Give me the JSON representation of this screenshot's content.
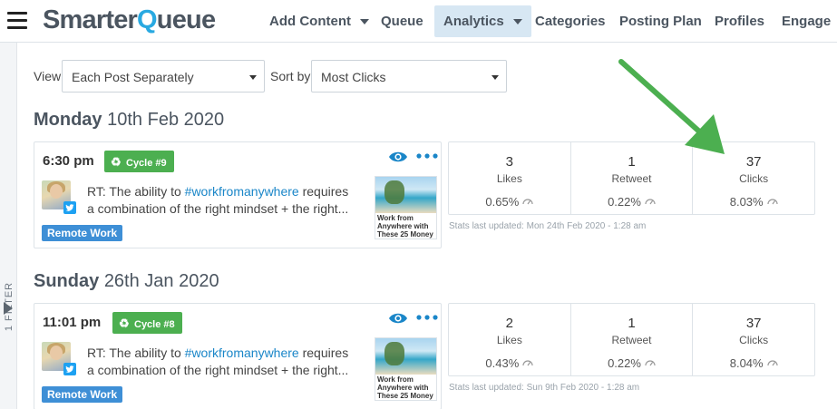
{
  "app": {
    "logo_part1": "Smarter",
    "logo_q": "Q",
    "logo_part2": "ueue"
  },
  "nav": [
    {
      "label": "Add Content",
      "has_caret": true
    },
    {
      "label": "Queue"
    },
    {
      "label": "Analytics",
      "active": true,
      "has_caret": true
    },
    {
      "label": "Categories"
    },
    {
      "label": "Posting Plan"
    },
    {
      "label": "Profiles"
    },
    {
      "label": "Engage"
    }
  ],
  "filter": {
    "label": "1 FILTER"
  },
  "controls": {
    "view_label": "View",
    "view_value": "Each Post Separately",
    "sort_label": "Sort by",
    "sort_value": "Most Clicks"
  },
  "days": [
    {
      "weekday": "Monday",
      "date": "10th Feb 2020",
      "post": {
        "time": "6:30 pm",
        "cycle": "Cycle #9",
        "text_prefix": "RT: The ability to ",
        "hashtag": "#workfromanywhere",
        "text_suffix": " requires",
        "text_line2": "a combination of the right mindset + the right...",
        "thumb_caption": "Work from Anywhere with These 25 Money ...",
        "category": "Remote Work"
      },
      "stats": [
        {
          "value": "3",
          "label": "Likes",
          "percent": "0.65%"
        },
        {
          "value": "1",
          "label": "Retweet",
          "percent": "0.22%"
        },
        {
          "value": "37",
          "label": "Clicks",
          "percent": "8.03%"
        }
      ],
      "updated": "Stats last updated: Mon 24th Feb 2020 - 1:28 am"
    },
    {
      "weekday": "Sunday",
      "date": "26th Jan 2020",
      "post": {
        "time": "11:01 pm",
        "cycle": "Cycle #8",
        "text_prefix": "RT: The ability to ",
        "hashtag": "#workfromanywhere",
        "text_suffix": " requires",
        "text_line2": "a combination of the right mindset + the right...",
        "thumb_caption": "Work from Anywhere with These 25 Money ...",
        "category": "Remote Work"
      },
      "stats": [
        {
          "value": "2",
          "label": "Likes",
          "percent": "0.43%"
        },
        {
          "value": "1",
          "label": "Retweet",
          "percent": "0.22%"
        },
        {
          "value": "37",
          "label": "Clicks",
          "percent": "8.04%"
        }
      ],
      "updated": "Stats last updated: Sun 9th Feb 2020 - 1:28 am"
    }
  ],
  "colors": {
    "accent": "#29a9e1",
    "cycle_badge": "#4caf50",
    "category_label": "#3e8fd6",
    "annotation_arrow": "#4caf50",
    "nav_active_bg": "#d7e7f3"
  },
  "icons": [
    "menu-icon",
    "recycle-icon",
    "eye-icon",
    "more-dots-icon",
    "twitter-icon",
    "gauge-icon",
    "filter-triangle-icon"
  ]
}
